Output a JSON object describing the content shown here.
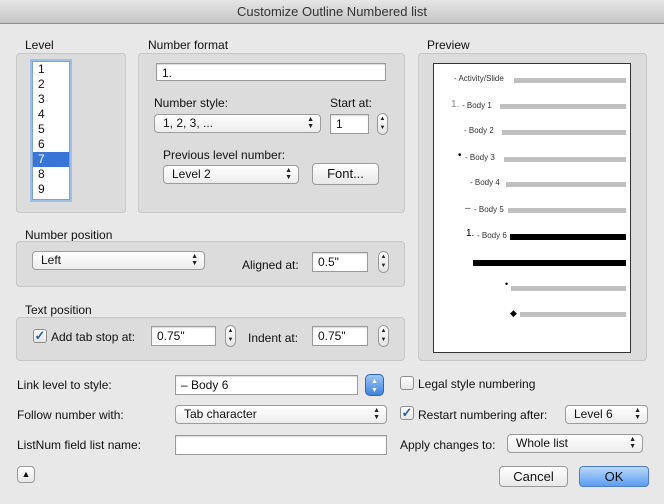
{
  "window": {
    "title": "Customize Outline Numbered list"
  },
  "level": {
    "label": "Level",
    "items": [
      "1",
      "2",
      "3",
      "4",
      "5",
      "6",
      "7",
      "8",
      "9"
    ],
    "selected": "7"
  },
  "number_format": {
    "label": "Number format",
    "format_value": "1.",
    "style_label": "Number style:",
    "style_value": "1, 2, 3, ...",
    "start_label": "Start at:",
    "start_value": "1",
    "prev_label": "Previous level number:",
    "prev_value": "Level 2",
    "font_button": "Font..."
  },
  "number_position": {
    "label": "Number position",
    "alignment_value": "Left",
    "aligned_label": "Aligned at:",
    "aligned_value": "0.5\""
  },
  "text_position": {
    "label": "Text position",
    "tab_stop_label": "Add tab stop at:",
    "tab_stop_checked": true,
    "tab_stop_value": "0.75\"",
    "indent_label": "Indent at:",
    "indent_value": "0.75\""
  },
  "preview": {
    "label": "Preview",
    "lines": [
      {
        "marker": "",
        "text": "- Activity/Slide"
      },
      {
        "marker": "1.",
        "text": "- Body 1"
      },
      {
        "marker": "",
        "text": "- Body 2"
      },
      {
        "marker": "•",
        "text": "- Body 3"
      },
      {
        "marker": "",
        "text": "- Body 4"
      },
      {
        "marker": "–",
        "text": "- Body 5"
      },
      {
        "marker": "1.",
        "text": "- Body 6"
      },
      {
        "marker": "",
        "text": ""
      },
      {
        "marker": "•",
        "text": ""
      },
      {
        "marker": "◆",
        "text": ""
      }
    ]
  },
  "bottom": {
    "link_label": "Link level to style:",
    "link_value": "– Body 6",
    "legal_label": "Legal style numbering",
    "legal_checked": false,
    "follow_label": "Follow number with:",
    "follow_value": "Tab character",
    "restart_label": "Restart numbering after:",
    "restart_checked": true,
    "restart_value": "Level 6",
    "listnum_label": "ListNum field list name:",
    "listnum_value": "",
    "apply_label": "Apply changes to:",
    "apply_value": "Whole list",
    "cancel_button": "Cancel",
    "ok_button": "OK"
  },
  "colors": {
    "accent": "#3875d7",
    "default_button": "#5d9cf0"
  }
}
